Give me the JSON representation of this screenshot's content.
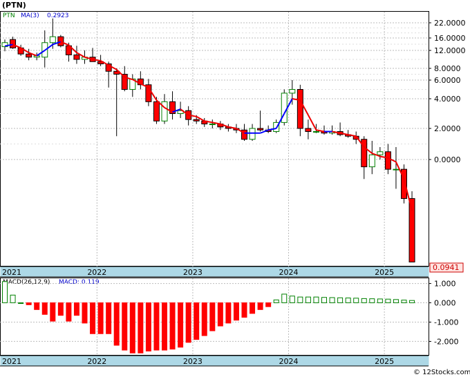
{
  "title": "(PTN)",
  "price_legend": {
    "symbol": "PTN",
    "ma_label": "MA(3)",
    "ma_value": "0.2923"
  },
  "macd_legend": {
    "label": "MACD(26,12,9)",
    "value_label": "MACD: 0.119"
  },
  "last_price": "0.0941",
  "footer": "© 12Stocks.com",
  "colors": {
    "up": "#ffffff",
    "down": "#ff0000",
    "up_border": "#008000",
    "down_border": "#cc0000",
    "ma_up": "#0000ff",
    "ma_down": "#ee0000",
    "macd_neg": "#ff0000",
    "macd_pos": "#008000",
    "axis_band": "#add8e6"
  },
  "chart_data": [
    {
      "type": "candlestick",
      "title": "(PTN)",
      "y_tick_labels": [
        "22.0000",
        "16.0000",
        "12.0000",
        "8.0000",
        "6.0000",
        "4.0000",
        "2.0000",
        "0.0000"
      ],
      "x_tick_labels": [
        "2021",
        "2022",
        "2023",
        "2024",
        "2025"
      ],
      "months": [
        "2021-01",
        "2021-02",
        "2021-03",
        "2021-04",
        "2021-05",
        "2021-06",
        "2021-07",
        "2021-08",
        "2021-09",
        "2021-10",
        "2021-11",
        "2021-12",
        "2022-01",
        "2022-02",
        "2022-03",
        "2022-04",
        "2022-05",
        "2022-06",
        "2022-07",
        "2022-08",
        "2022-09",
        "2022-10",
        "2022-11",
        "2022-12",
        "2023-01",
        "2023-02",
        "2023-03",
        "2023-04",
        "2023-05",
        "2023-06",
        "2023-07",
        "2023-08",
        "2023-09",
        "2023-10",
        "2023-11",
        "2023-12",
        "2024-01",
        "2024-02",
        "2024-03",
        "2024-04",
        "2024-05",
        "2024-06",
        "2024-07",
        "2024-08",
        "2024-09",
        "2024-10",
        "2024-11",
        "2024-12",
        "2025-01",
        "2025-02",
        "2025-03",
        "2025-04"
      ],
      "ohlc": [
        [
          13.2,
          15.5,
          11.8,
          14.5
        ],
        [
          15.5,
          16.5,
          12.5,
          12.8
        ],
        [
          12.8,
          13.8,
          10.8,
          11.2
        ],
        [
          11.2,
          12.5,
          9.8,
          10.5
        ],
        [
          10.5,
          11.5,
          9.8,
          10.8
        ],
        [
          10.5,
          19.0,
          8.2,
          14.5
        ],
        [
          14.5,
          24.5,
          12.5,
          16.5
        ],
        [
          16.5,
          17.2,
          13.0,
          13.5
        ],
        [
          13.5,
          14.5,
          9.5,
          11.0
        ],
        [
          11.0,
          13.5,
          9.0,
          10.0
        ],
        [
          10.0,
          12.0,
          9.0,
          10.5
        ],
        [
          10.5,
          12.8,
          9.5,
          9.5
        ],
        [
          9.5,
          11.0,
          8.5,
          9.0
        ],
        [
          9.0,
          9.5,
          5.2,
          7.5
        ],
        [
          7.5,
          8.0,
          1.5,
          7.0
        ],
        [
          7.0,
          8.5,
          4.8,
          5.0
        ],
        [
          5.0,
          7.0,
          4.2,
          6.2
        ],
        [
          6.2,
          7.5,
          5.0,
          5.5
        ],
        [
          5.5,
          6.2,
          3.5,
          3.8
        ],
        [
          3.8,
          4.2,
          2.3,
          2.5
        ],
        [
          2.5,
          4.5,
          2.3,
          3.8
        ],
        [
          3.8,
          4.8,
          2.6,
          3.0
        ],
        [
          3.0,
          3.8,
          2.7,
          3.2
        ],
        [
          3.2,
          3.5,
          2.2,
          2.6
        ],
        [
          2.6,
          2.9,
          2.3,
          2.5
        ],
        [
          2.5,
          2.7,
          2.1,
          2.3
        ],
        [
          2.3,
          2.6,
          2.0,
          2.3
        ],
        [
          2.3,
          2.5,
          1.9,
          2.1
        ],
        [
          2.1,
          2.3,
          1.8,
          2.0
        ],
        [
          2.0,
          2.3,
          1.7,
          1.9
        ],
        [
          1.9,
          2.3,
          1.2,
          1.3
        ],
        [
          1.3,
          2.3,
          1.2,
          2.0
        ],
        [
          2.0,
          3.2,
          1.8,
          1.9
        ],
        [
          1.9,
          2.2,
          1.7,
          1.8
        ],
        [
          1.8,
          2.6,
          1.7,
          2.4
        ],
        [
          2.4,
          5.0,
          2.2,
          4.6
        ],
        [
          4.6,
          6.0,
          3.6,
          5.0
        ],
        [
          5.0,
          5.5,
          1.5,
          2.0
        ],
        [
          2.0,
          2.6,
          1.3,
          1.8
        ],
        [
          1.8,
          2.3,
          1.7,
          1.8
        ],
        [
          1.8,
          2.2,
          1.6,
          1.7
        ],
        [
          1.7,
          2.2,
          1.6,
          1.8
        ],
        [
          1.8,
          2.4,
          1.5,
          1.6
        ],
        [
          1.6,
          1.9,
          1.4,
          1.5
        ],
        [
          1.5,
          1.8,
          1.0,
          1.3
        ],
        [
          1.3,
          1.5,
          -0.8,
          -0.3
        ],
        [
          -0.3,
          1.2,
          -0.6,
          0.3
        ],
        [
          0.3,
          0.8,
          0.0,
          0.5
        ],
        [
          0.5,
          1.0,
          -0.6,
          -0.4
        ],
        [
          -0.4,
          0.8,
          -1.2,
          -0.4
        ],
        [
          -0.4,
          -0.2,
          -1.8,
          -1.6
        ],
        [
          -1.6,
          -1.3,
          -4.2,
          -4.2
        ]
      ],
      "ma3": [
        13.4,
        13.9,
        12.8,
        11.5,
        10.8,
        12.0,
        13.9,
        14.8,
        13.7,
        11.5,
        10.5,
        10.0,
        9.7,
        8.7,
        7.8,
        6.5,
        6.1,
        5.6,
        5.2,
        3.9,
        3.4,
        3.1,
        3.3,
        2.9,
        2.8,
        2.5,
        2.4,
        2.3,
        2.1,
        2.0,
        1.7,
        1.7,
        1.7,
        1.9,
        2.0,
        3.0,
        4.0,
        3.9,
        2.9,
        1.9,
        1.8,
        1.8,
        1.7,
        1.6,
        1.5,
        0.8,
        0.4,
        0.2,
        0.1,
        -0.1,
        -0.8,
        -2.1
      ],
      "ylim": [
        -4.3,
        24
      ]
    },
    {
      "type": "bar",
      "title": "MACD(26,12,9)",
      "y_tick_labels": [
        "1.000",
        "0.000",
        "-1.000",
        "-2.000"
      ],
      "x_tick_labels": [
        "2021",
        "2022",
        "2023",
        "2024",
        "2025"
      ],
      "values": [
        1.1,
        0.4,
        0.0,
        -0.1,
        -0.35,
        -0.6,
        -0.95,
        -0.65,
        -0.95,
        -0.65,
        -1.05,
        -1.6,
        -1.6,
        -1.6,
        -2.2,
        -2.45,
        -2.6,
        -2.6,
        -2.5,
        -2.45,
        -2.45,
        -2.4,
        -2.3,
        -2.05,
        -1.9,
        -1.7,
        -1.45,
        -1.2,
        -1.05,
        -0.9,
        -0.75,
        -0.55,
        -0.35,
        -0.2,
        0.15,
        0.45,
        0.35,
        0.3,
        0.3,
        0.3,
        0.28,
        0.27,
        0.26,
        0.25,
        0.24,
        0.22,
        0.21,
        0.2,
        0.19,
        0.17,
        0.14,
        0.12
      ],
      "ylim": [
        -2.7,
        1.2
      ]
    }
  ]
}
